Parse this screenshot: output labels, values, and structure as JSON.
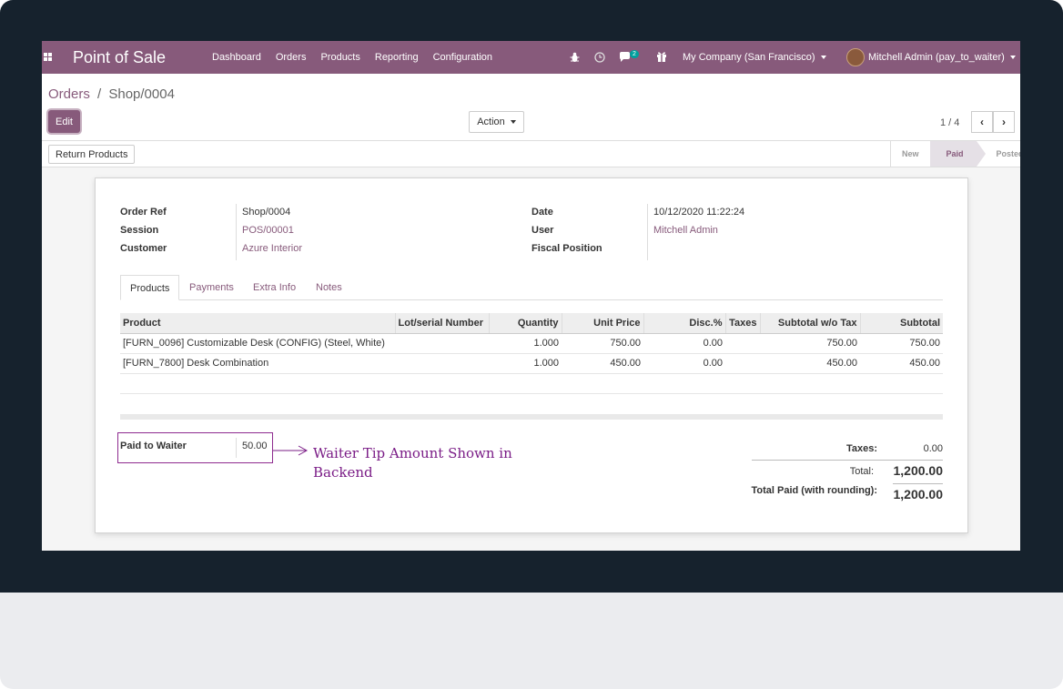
{
  "navbar": {
    "app_title": "Point of Sale",
    "menu": [
      "Dashboard",
      "Orders",
      "Products",
      "Reporting",
      "Configuration"
    ],
    "message_count": "2",
    "company": "My Company (San Francisco)",
    "user": "Mitchell Admin (pay_to_waiter)"
  },
  "breadcrumb": {
    "parent": "Orders",
    "separator": "/",
    "current": "Shop/0004"
  },
  "controls": {
    "edit_label": "Edit",
    "action_label": "Action",
    "pager": "1 / 4"
  },
  "statusbar": {
    "return_label": "Return Products",
    "stages": [
      "New",
      "Paid",
      "Posted"
    ],
    "active_stage": "Paid"
  },
  "order": {
    "order_ref_label": "Order Ref",
    "order_ref": "Shop/0004",
    "session_label": "Session",
    "session": "POS/00001",
    "customer_label": "Customer",
    "customer": "Azure Interior",
    "date_label": "Date",
    "date": "10/12/2020 11:22:24",
    "user_label": "User",
    "user": "Mitchell Admin",
    "fiscal_label": "Fiscal Position",
    "fiscal": ""
  },
  "tabs": [
    "Products",
    "Payments",
    "Extra Info",
    "Notes"
  ],
  "lines": {
    "headers": [
      "Product",
      "Lot/serial Number",
      "Quantity",
      "Unit Price",
      "Disc.%",
      "Taxes",
      "Subtotal w/o Tax",
      "Subtotal"
    ],
    "rows": [
      [
        "[FURN_0096] Customizable Desk (CONFIG) (Steel, White)",
        "",
        "1.000",
        "750.00",
        "0.00",
        "",
        "750.00",
        "750.00"
      ],
      [
        "[FURN_7800] Desk Combination",
        "",
        "1.000",
        "450.00",
        "0.00",
        "",
        "450.00",
        "450.00"
      ]
    ]
  },
  "tip": {
    "label": "Paid to Waiter",
    "value": "50.00"
  },
  "annotation": "Waiter Tip Amount Shown in Backend",
  "totals": {
    "taxes_label": "Taxes:",
    "taxes": "0.00",
    "total_label": "Total:",
    "total": "1,200.00",
    "paid_label": "Total Paid (with rounding):",
    "paid": "1,200.00"
  },
  "colors": {
    "brand": "#875a7b",
    "annotation": "#7a1c86",
    "frame": "#16222d"
  }
}
